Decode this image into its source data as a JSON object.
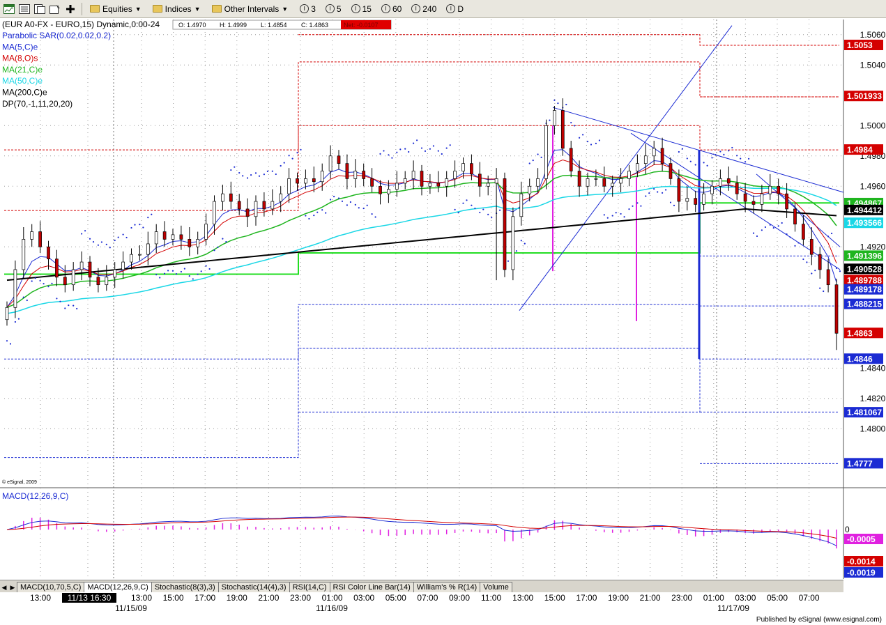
{
  "toolbar": {
    "menus": [
      "Equities",
      "Indices",
      "Other Intervals"
    ],
    "intervals": [
      "3",
      "5",
      "15",
      "60",
      "240",
      "D"
    ]
  },
  "header": {
    "symbol_line": "(EUR A0-FX - EURO,15) Dynamic,0:00-24",
    "ohlc": {
      "open": "O: 1.4970",
      "high": "H: 1.4999",
      "low": "L: 1.4854",
      "close": "C: 1.4863",
      "net": "Net: -0.0107"
    },
    "studies": [
      {
        "label": "Parabolic SAR(0.02,0.02,0.2)",
        "color": "#1b2bd3"
      },
      {
        "label": "MA(5,C)e",
        "color": "#1b2bd3"
      },
      {
        "label": "MA(8,O)s",
        "color": "#d40000"
      },
      {
        "label": "MA(21,C)e",
        "color": "#1fb51f"
      },
      {
        "label": "MA(50,C)e",
        "color": "#1ad7e6"
      },
      {
        "label": "MA(200,C)e",
        "color": "#000000"
      },
      {
        "label": "DP(70,-1,11,20,20)",
        "color": "#000000"
      }
    ],
    "copyright": "© eSignal, 2009"
  },
  "macd": {
    "label": "MACD(12,26,9,C)",
    "zero_label": "0",
    "values": [
      "-0.0005",
      "-0.0014",
      "-0.0019"
    ]
  },
  "tabs": [
    "MACD(10,70,5,C)",
    "MACD(12,26,9,C)",
    "Stochastic(8(3),3)",
    "Stochastic(14(4),3)",
    "RSI(14,C)",
    "RSI Color Line Bar(14)",
    "William's % R(14)",
    "Volume"
  ],
  "active_tab": 1,
  "time_axis": {
    "labels": [
      "13:00",
      "11/13 16:30",
      "13:00",
      "15:00",
      "17:00",
      "19:00",
      "21:00",
      "23:00",
      "01:00",
      "03:00",
      "05:00",
      "07:00",
      "09:00",
      "11:00",
      "13:00",
      "15:00",
      "17:00",
      "19:00",
      "21:00",
      "23:00",
      "01:00",
      "03:00",
      "05:00",
      "07:00"
    ],
    "dates": [
      "11/15/09",
      "11/16/09",
      "11/17/09"
    ]
  },
  "footer": "Published by eSignal (www.esignal.com)",
  "colors": {
    "up": "#ffffff",
    "down": "#c00000",
    "sar": "#1b2bd3",
    "ma5": "#1b2bd3",
    "ma8": "#d40000",
    "ma21": "#1fb51f",
    "ma50": "#1ad7e6",
    "ma200": "#000000",
    "pivot_red": "#d40000",
    "pivot_blue": "#1b2bd3",
    "pivot_green": "#22dd22",
    "magenta": "#e020e0"
  },
  "chart_data": {
    "type": "candlestick",
    "interval": "15 min",
    "ylim": [
      1.4762,
      1.507
    ],
    "y_ticks": [
      1.506,
      1.504,
      1.5,
      1.498,
      1.496,
      1.492,
      1.484,
      1.482,
      1.48
    ],
    "price_labels": [
      {
        "value": "1.5053",
        "color": "#d40000"
      },
      {
        "value": "1.501933",
        "color": "#d40000"
      },
      {
        "value": "1.4984",
        "color": "#d40000"
      },
      {
        "value": "1.494867",
        "color": "#1fb51f"
      },
      {
        "value": "1.494412",
        "color": "#000000"
      },
      {
        "value": "1.493566",
        "color": "#1ad7e6"
      },
      {
        "value": "1.491396",
        "color": "#1fb51f"
      },
      {
        "value": "1.490528",
        "color": "#000000"
      },
      {
        "value": "1.489788",
        "color": "#d40000"
      },
      {
        "value": "1.489178",
        "color": "#1b2bd3"
      },
      {
        "value": "1.488215",
        "color": "#1b2bd3"
      },
      {
        "value": "1.4863",
        "color": "#d40000"
      },
      {
        "value": "1.4846",
        "color": "#1b2bd3"
      },
      {
        "value": "1.481067",
        "color": "#1b2bd3"
      },
      {
        "value": "1.4777",
        "color": "#1b2bd3"
      }
    ],
    "pivot_levels": {
      "day_11_13": {
        "r2": 1.4984,
        "r1": 1.4944,
        "pivot": 1.4902,
        "s1": 1.4846,
        "s2": 1.4781
      },
      "day_11_16": {
        "r3": 1.506,
        "r2": 1.5042,
        "r1": 1.5,
        "pivot": 1.4916,
        "s1": 1.4882,
        "s2": 1.4853,
        "s3": 1.4811
      },
      "day_11_17": {
        "r3": 1.5053,
        "r2": 1.5019,
        "r1": 1.4984,
        "pivot": 1.4949,
        "s1": 1.4914,
        "s2": 1.4881,
        "s3": 1.4846,
        "s4": 1.4811,
        "s5": 1.4777
      }
    },
    "closes": [
      1.488,
      1.4905,
      1.4925,
      1.493,
      1.492,
      1.4912,
      1.49,
      1.4895,
      1.4905,
      1.491,
      1.49,
      1.4895,
      1.49,
      1.4905,
      1.491,
      1.4915,
      1.4915,
      1.4922,
      1.493,
      1.4925,
      1.4928,
      1.4925,
      1.492,
      1.4925,
      1.4935,
      1.495,
      1.4955,
      1.495,
      1.4945,
      1.494,
      1.495,
      1.4945,
      1.495,
      1.4955,
      1.4965,
      1.4962,
      1.4965,
      1.4963,
      1.497,
      1.498,
      1.4975,
      1.4965,
      1.497,
      1.4965,
      1.496,
      1.4955,
      1.4958,
      1.4962,
      1.4965,
      1.497,
      1.496,
      1.4962,
      1.496,
      1.4965,
      1.497,
      1.4975,
      1.4968,
      1.496,
      1.4962,
      1.4965,
      1.4905,
      1.494,
      1.4955,
      1.496,
      1.4965,
      1.5,
      1.501,
      1.4985,
      1.497,
      1.496,
      1.4965,
      1.4965,
      1.496,
      1.4962,
      1.4965,
      1.497,
      1.4975,
      1.498,
      1.4985,
      1.4975,
      1.4965,
      1.495,
      1.4952,
      1.4948,
      1.4955,
      1.496,
      1.4965,
      1.4962,
      1.4955,
      1.495,
      1.4948,
      1.4955,
      1.496,
      1.4955,
      1.4945,
      1.4935,
      1.4925,
      1.4915,
      1.4905,
      1.4895,
      1.4863
    ],
    "macd": {
      "line": -0.0019,
      "signal": -0.0014,
      "histogram": -0.0005
    }
  }
}
